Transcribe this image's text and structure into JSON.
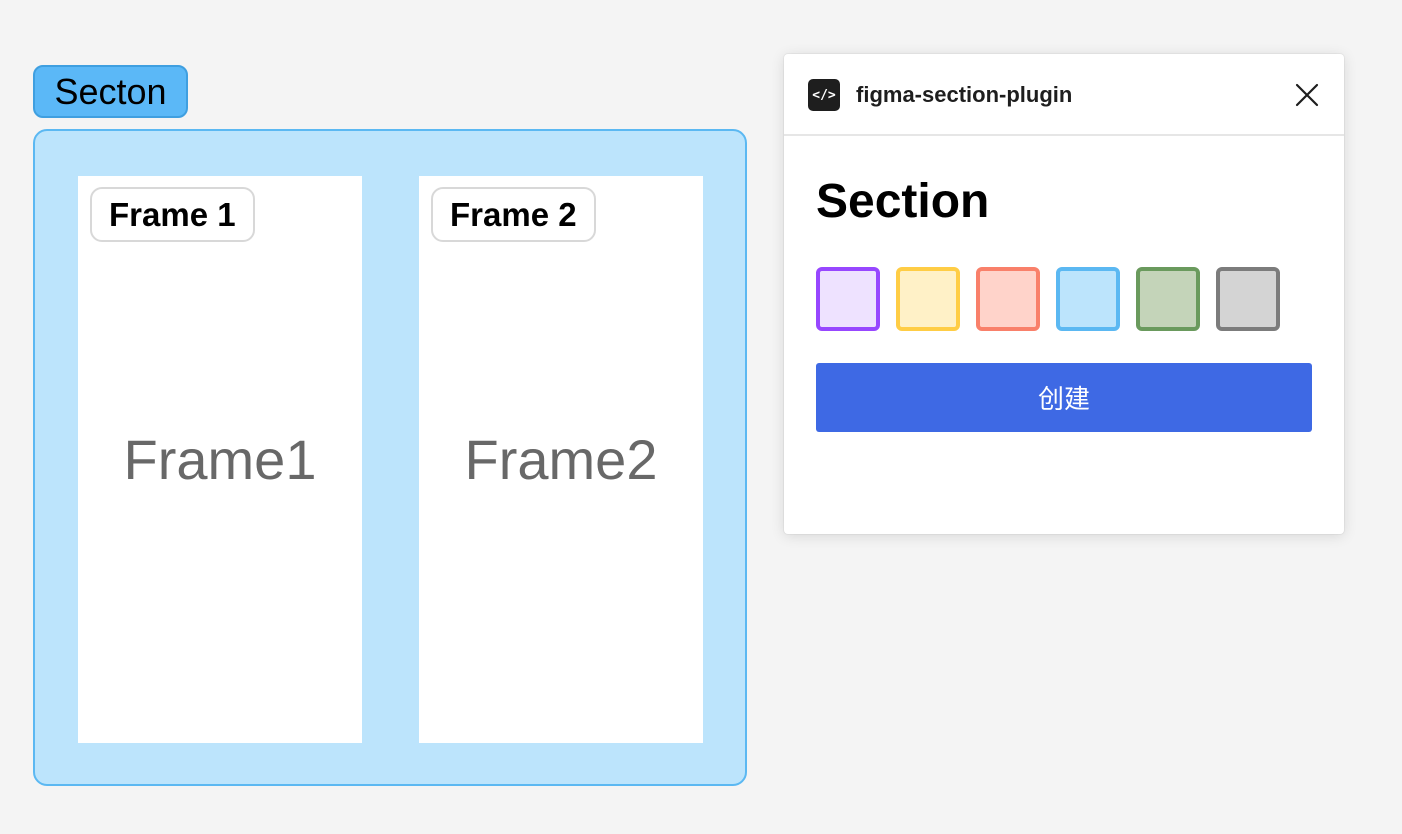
{
  "canvas": {
    "section_label": "Secton",
    "frames": [
      {
        "tag": "Frame 1",
        "content": "Frame1"
      },
      {
        "tag": "Frame 2",
        "content": "Frame2"
      }
    ]
  },
  "plugin": {
    "icon": "code-icon",
    "icon_glyph": "</>",
    "title": "figma-section-plugin",
    "close_icon": "close-icon",
    "heading": "Section",
    "swatches": [
      {
        "name": "purple",
        "fill": "#eee2ff",
        "border": "#9747ff"
      },
      {
        "name": "yellow",
        "fill": "#fff1c7",
        "border": "#ffcd45"
      },
      {
        "name": "red",
        "fill": "#ffd3ca",
        "border": "#f9806a"
      },
      {
        "name": "blue",
        "fill": "#bce4fc",
        "border": "#5bb8f2"
      },
      {
        "name": "green",
        "fill": "#c4d4b9",
        "border": "#6a9a5d"
      },
      {
        "name": "gray",
        "fill": "#d4d4d4",
        "border": "#7c7c7c"
      }
    ],
    "create_label": "创建",
    "create_color": "#3e69e4"
  }
}
